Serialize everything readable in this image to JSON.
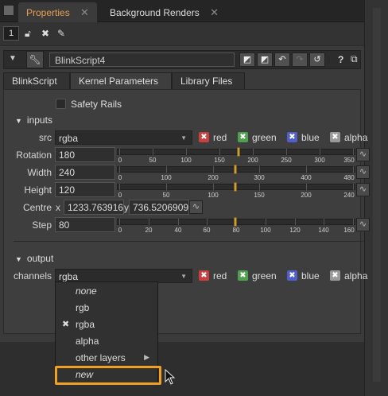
{
  "tabs": [
    {
      "label": "Properties",
      "active": true
    },
    {
      "label": "Background Renders",
      "active": false
    }
  ],
  "toolbar": {
    "panel_count": "1"
  },
  "node": {
    "name": "BlinkScript4",
    "subtabs": [
      "BlinkScript",
      "Kernel Parameters",
      "Library Files"
    ],
    "active_subtab": "Kernel Parameters"
  },
  "params": {
    "safety_rails_label": "Safety Rails",
    "inputs_label": "inputs",
    "src_label": "src",
    "src_value": "rgba",
    "channels": [
      "red",
      "green",
      "blue",
      "alpha"
    ],
    "rotation": {
      "label": "Rotation",
      "value": "180",
      "ticks": [
        "0",
        "50",
        "100",
        "150",
        "200",
        "250",
        "300",
        "350"
      ],
      "handle_fraction": 0.514
    },
    "width": {
      "label": "Width",
      "value": "240",
      "ticks": [
        "0",
        "100",
        "200",
        "300",
        "400",
        "480"
      ],
      "handle_fraction": 0.5
    },
    "height": {
      "label": "Height",
      "value": "120",
      "ticks": [
        "0",
        "50",
        "100",
        "150",
        "200",
        "240"
      ],
      "handle_fraction": 0.5
    },
    "centre": {
      "label": "Centre",
      "x_label": "x",
      "x_value": "1233.763916",
      "y_label": "y",
      "y_value": "736.5206909"
    },
    "step": {
      "label": "Step",
      "value": "80",
      "ticks": [
        "0",
        "20",
        "40",
        "60",
        "80",
        "100",
        "120",
        "140",
        "160"
      ],
      "handle_fraction": 0.5
    },
    "output_label": "output",
    "channels_label": "channels",
    "channels_value": "rgba"
  },
  "menu": {
    "items": [
      {
        "label": "none",
        "italic": true,
        "checked": false,
        "submenu": false
      },
      {
        "label": "rgb",
        "italic": false,
        "checked": false,
        "submenu": false
      },
      {
        "label": "rgba",
        "italic": false,
        "checked": true,
        "submenu": false
      },
      {
        "label": "alpha",
        "italic": false,
        "checked": false,
        "submenu": false
      },
      {
        "label": "other layers",
        "italic": false,
        "checked": false,
        "submenu": true
      },
      {
        "label": "new",
        "italic": true,
        "checked": false,
        "submenu": false
      }
    ]
  },
  "colors": {
    "red": "#c84040",
    "green": "#50a050",
    "blue": "#5060c8",
    "alpha": "#9a9a9a",
    "highlight": "#f0a020",
    "tab_active": "#e8a050"
  }
}
